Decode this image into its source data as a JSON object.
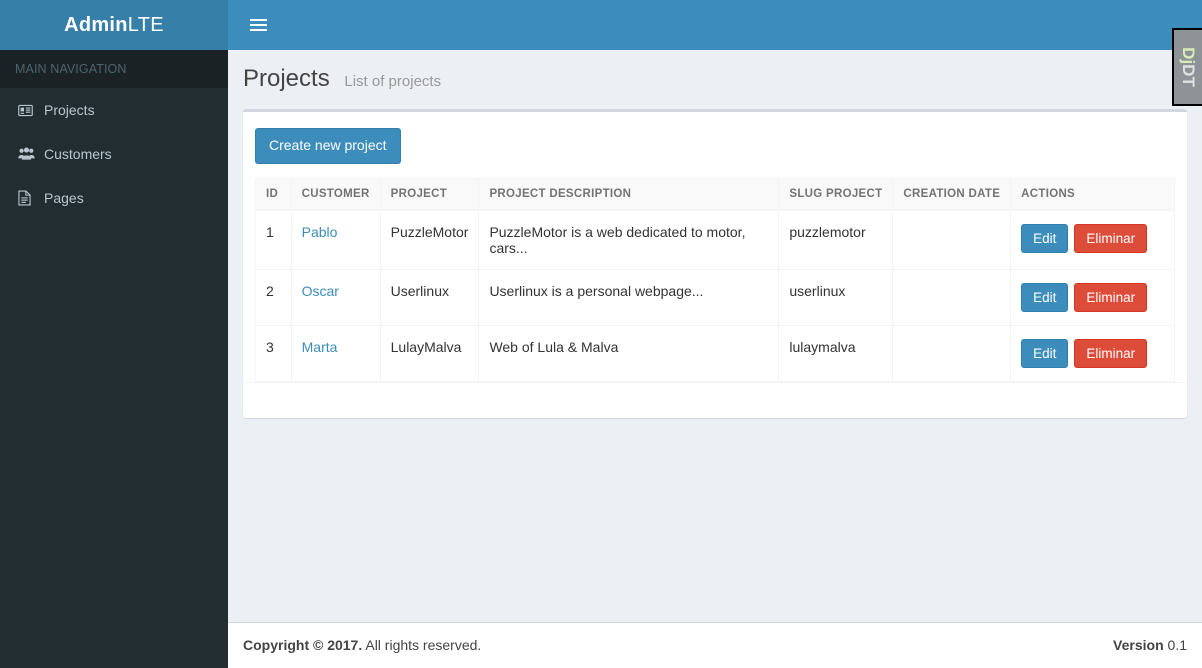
{
  "brand": {
    "bold": "Admin",
    "light": "LTE"
  },
  "navbar": {
    "toggle_label": "Toggle navigation"
  },
  "sidebar": {
    "header": "MAIN NAVIGATION",
    "items": [
      {
        "label": "Projects",
        "icon": "id-card-icon"
      },
      {
        "label": "Customers",
        "icon": "users-icon"
      },
      {
        "label": "Pages",
        "icon": "file-icon"
      }
    ]
  },
  "page": {
    "title": "Projects",
    "subtitle": "List of projects"
  },
  "toolbar": {
    "create_label": "Create new project"
  },
  "table": {
    "columns": [
      "ID",
      "CUSTOMER",
      "PROJECT",
      "PROJECT DESCRIPTION",
      "SLUG PROJECT",
      "CREATION DATE",
      "ACTIONS"
    ],
    "rows": [
      {
        "id": "1",
        "customer": "Pablo",
        "project": "PuzzleMotor",
        "description": "PuzzleMotor is a web dedicated to motor, cars...",
        "slug": "puzzlemotor",
        "creation_date": "",
        "edit_label": "Edit",
        "delete_label": "Eliminar"
      },
      {
        "id": "2",
        "customer": "Oscar",
        "project": "Userlinux",
        "description": "Userlinux is a personal webpage...",
        "slug": "userlinux",
        "creation_date": "",
        "edit_label": "Edit",
        "delete_label": "Eliminar"
      },
      {
        "id": "3",
        "customer": "Marta",
        "project": "LulayMalva",
        "description": "Web of Lula & Malva",
        "slug": "lulaymalva",
        "creation_date": "",
        "edit_label": "Edit",
        "delete_label": "Eliminar"
      }
    ]
  },
  "footer": {
    "copyright_bold": "Copyright © 2017.",
    "copyright_rest": " All rights reserved.",
    "version_label": "Version",
    "version_value": " 0.1"
  },
  "debug_toolbar": {
    "label_first": "Dj",
    "label_second": "DT"
  },
  "colors": {
    "brand_blue": "#3c8dbc",
    "brand_blue_dark": "#367fa9",
    "sidebar_dark": "#222d32",
    "sidebar_header": "#1a2226",
    "content_bg": "#ecf0f5",
    "danger_red": "#dd4b39",
    "link_blue": "#3c8dbc"
  }
}
